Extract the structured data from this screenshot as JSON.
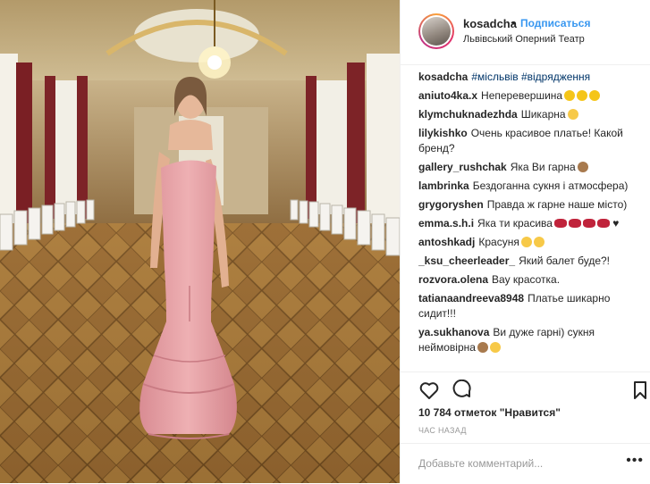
{
  "post": {
    "username": "kosadcha",
    "dot": "•",
    "follow_label": "Подписаться",
    "location": "Львівський Оперний Театр",
    "caption_user": "kosadcha",
    "caption_tags": "#місльвів #відрядження",
    "likes": "10 784 отметок \"Нравится\"",
    "time": "ЧАС НАЗАД",
    "add_comment_placeholder": "Добавьте комментарий...",
    "more_glyph": "•••"
  },
  "comments": [
    {
      "user": "aniuto4ka.x",
      "text": "Неперевершина",
      "emoji": [
        "heart-yellow",
        "heart-yellow",
        "heart-yellow"
      ]
    },
    {
      "user": "klymchuknadezhda",
      "text": "Шикарна",
      "emoji": [
        "smile"
      ]
    },
    {
      "user": "lilykishko",
      "text": "Очень красивое платье! Какой бренд?",
      "emoji": []
    },
    {
      "user": "gallery_rushchak",
      "text": "Яка Ви гарна",
      "emoji": [
        "monkey"
      ]
    },
    {
      "user": "lambrinka",
      "text": "Бездоганна сукня і атмосфера)",
      "emoji": []
    },
    {
      "user": "grygoryshen",
      "text": "Правда ж гарне наше місто)",
      "emoji": []
    },
    {
      "user": "emma.s.h.i",
      "text": "Яка ти красива",
      "emoji": [
        "lips",
        "lips",
        "lips",
        "lips",
        "black-heart"
      ]
    },
    {
      "user": "antoshkadj",
      "text": "Красуня",
      "emoji": [
        "smile",
        "smile"
      ]
    },
    {
      "user": "_ksu_cheerleader_",
      "text": "Який балет буде?!",
      "emoji": []
    },
    {
      "user": "rozvora.olena",
      "text": "Вау красотка.",
      "emoji": []
    },
    {
      "user": "tatianaandreeva8948",
      "text": "Платье шикарно сидит!!!",
      "emoji": []
    },
    {
      "user": "ya.sukhanova",
      "text": "Ви дуже гарні) сукня неймовірна",
      "emoji": [
        "monkey",
        "smile"
      ]
    }
  ],
  "colors": {
    "follow": "#3897f0",
    "dress": "#e9a2a6",
    "floor": "#9a6b32"
  },
  "icons": [
    "heart-icon",
    "comment-icon",
    "bookmark-icon"
  ]
}
